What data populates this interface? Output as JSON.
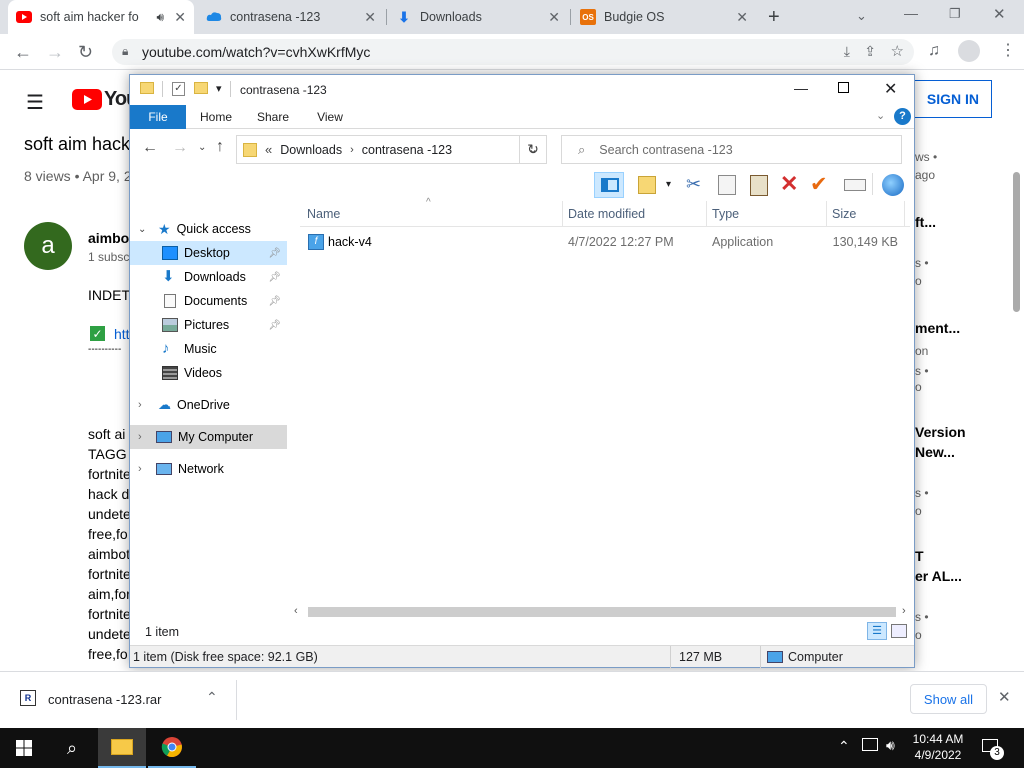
{
  "browser": {
    "tabs": [
      {
        "title": "soft aim hacker fo",
        "favicon": "youtube-icon"
      },
      {
        "title": "contrasena -123",
        "favicon": "cloud-icon"
      },
      {
        "title": "Downloads",
        "favicon": "download-icon"
      },
      {
        "title": "Budgie OS",
        "favicon": "budgie-icon"
      }
    ],
    "budgie_favicon_text": "OS",
    "url": "youtube.com/watch?v=cvhXwKrfMyc"
  },
  "youtube": {
    "logo_text": "You",
    "sign_in": "SIGN IN",
    "video_title": "soft aim hack",
    "views": "8 views • Apr 9, 2",
    "avatar_letter": "a",
    "channel": "aimbo",
    "subs": "1 subsc",
    "desc_head": "INDETE",
    "link_text": "htt",
    "dashes": "----------",
    "desc_lines": [
      "soft ai",
      "TAGG",
      "fortnite",
      "hack d",
      "undete",
      "free,fo",
      "aimbot",
      "fortnite",
      "aim,for",
      "fortnite",
      "undete",
      "free,fo"
    ],
    "sidebar": [
      {
        "text": "ws •",
        "cls": "muted"
      },
      {
        "text": "ago",
        "cls": "muted"
      },
      {
        "text": "ft...",
        "cls": "bold"
      },
      {
        "text": "s •",
        "cls": "muted"
      },
      {
        "text": "o",
        "cls": "muted"
      },
      {
        "text": "ment...",
        "cls": "bold"
      },
      {
        "text": "on",
        "cls": "muted"
      },
      {
        "text": "s •",
        "cls": "muted"
      },
      {
        "text": "o",
        "cls": "muted"
      },
      {
        "text": "Version",
        "cls": "bold"
      },
      {
        "text": "New...",
        "cls": "bold"
      },
      {
        "text": "s •",
        "cls": "muted"
      },
      {
        "text": "o",
        "cls": "muted"
      },
      {
        "text": "T",
        "cls": "bold"
      },
      {
        "text": "er AL...",
        "cls": "bold"
      },
      {
        "text": "s •",
        "cls": "muted"
      },
      {
        "text": "o",
        "cls": "muted"
      }
    ]
  },
  "explorer": {
    "title": "contrasena -123",
    "ribbon_tabs": [
      "File",
      "Home",
      "Share",
      "View"
    ],
    "breadcrumb": [
      "Downloads",
      "contrasena -123"
    ],
    "breadcrumb_prefix": "«",
    "search_placeholder": "Search contrasena -123",
    "nav": {
      "quick_access": "Quick access",
      "quick_items": [
        "Desktop",
        "Downloads",
        "Documents",
        "Pictures",
        "Music",
        "Videos"
      ],
      "onedrive": "OneDrive",
      "my_computer": "My Computer",
      "network": "Network"
    },
    "columns": [
      "Name",
      "Date modified",
      "Type",
      "Size"
    ],
    "files": [
      {
        "name": "hack-v4",
        "date": "4/7/2022 12:27 PM",
        "type": "Application",
        "size": "130,149 KB"
      }
    ],
    "item_count": "1 item",
    "status_free": "1 item (Disk free space: 92.1 GB)",
    "status_size": "127 MB",
    "status_location": "Computer"
  },
  "shelf": {
    "file": "contrasena -123.rar",
    "show_all": "Show all"
  },
  "taskbar": {
    "time": "10:44 AM",
    "date": "4/9/2022",
    "notif_count": "3"
  },
  "colors": {
    "file_tab": "#1979ca",
    "selection": "#cce8ff",
    "youtube_red": "#ff0000",
    "avatar": "#33691e"
  }
}
